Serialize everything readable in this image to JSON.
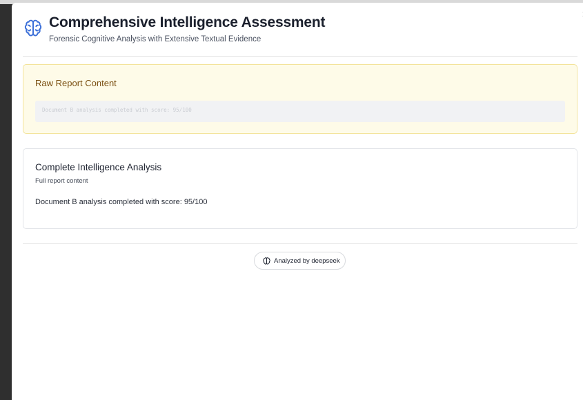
{
  "dialog": {
    "title": "Comprehensive Intelligence Assessment",
    "subtitle": "Forensic Cognitive Analysis with Extensive Textual Evidence",
    "close_icon": "close-icon",
    "header_icon": "brain-icon",
    "accent_color": "#3b6fd8"
  },
  "raw_report": {
    "heading": "Raw Report Content",
    "content": "Document B analysis completed with score: 95/100"
  },
  "analysis": {
    "heading": "Complete Intelligence Analysis",
    "subheading": "Full report content",
    "body": "Document B analysis completed with score: 95/100"
  },
  "footer": {
    "badge_label": "Analyzed by deepseek",
    "badge_icon": "brain-icon"
  }
}
